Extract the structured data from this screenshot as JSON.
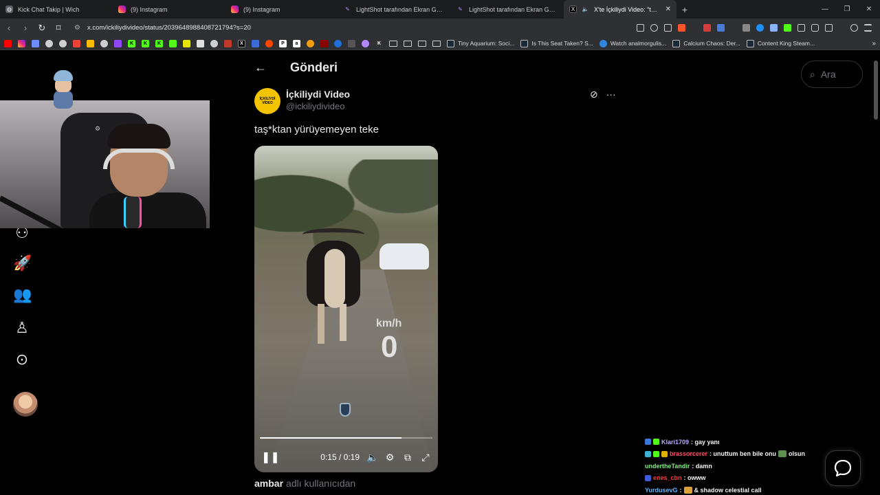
{
  "browser": {
    "tabs": [
      {
        "label": "Kick Chat Takip | Wich",
        "favicon": "globe-icon",
        "active": false
      },
      {
        "label": "(9) Instagram",
        "favicon": "instagram-icon",
        "active": false
      },
      {
        "label": "(9) Instagram",
        "favicon": "instagram-icon",
        "active": false
      },
      {
        "label": "LightShot tarafından Ekran Görüntüsü",
        "favicon": "lightshot-icon",
        "active": false
      },
      {
        "label": "LightShot tarafından Ekran Görüntüsü",
        "favicon": "lightshot-icon",
        "active": false
      },
      {
        "label": "X'te İçkiliydi Video: \"taş*ktan",
        "favicon": "x-icon",
        "active": true
      }
    ],
    "url": "x.com/ickiliydivideo/status/2039648988408721794?s=20",
    "bookmark_links": [
      {
        "label": "Tiny Aquarium: Soci..."
      },
      {
        "label": "Is This Seat Taken? S..."
      },
      {
        "label": "Watch analmorgulis..."
      },
      {
        "label": "Calcium Chaos: Der..."
      },
      {
        "label": "Content King Steam..."
      }
    ],
    "accent_colors": {
      "brave": "#fb542b",
      "tab_active": "#2f3033",
      "toolbar": "#2f3033"
    }
  },
  "page": {
    "header_title": "Gönderi",
    "search_placeholder": "Ara",
    "author": {
      "name": "İçkiliydi Video",
      "handle": "@ickiliydivideo",
      "avatar_text": "İÇKİLİYDİ VİDEO"
    },
    "post_text": "taş*ktan yürüyemeyen teke",
    "video": {
      "speed_unit": "km/h",
      "speed_value": "0",
      "time": "0:15 / 0:19",
      "progress": 0.82
    },
    "quote_user": "ambar",
    "quote_suffix": "adlı kullanıcıdan"
  },
  "chat": [
    {
      "user": "Klari1709",
      "user_color": "#b9a8ff",
      "msg": ": gay yanı"
    },
    {
      "user": "brassorcerer",
      "user_color": "#ff4f6a",
      "msg": ": unuttum ben bile onu",
      "msg2": "olsun"
    },
    {
      "user": "undertheTandir",
      "user_color": "#7cf07c",
      "msg": ": damn"
    },
    {
      "user": "enes_cbn",
      "user_color": "#ff3b3b",
      "msg": ": owww"
    },
    {
      "user": "YurdusevG",
      "user_color": "#5fb7ff",
      "msg": ": & shadow celestial call"
    }
  ]
}
